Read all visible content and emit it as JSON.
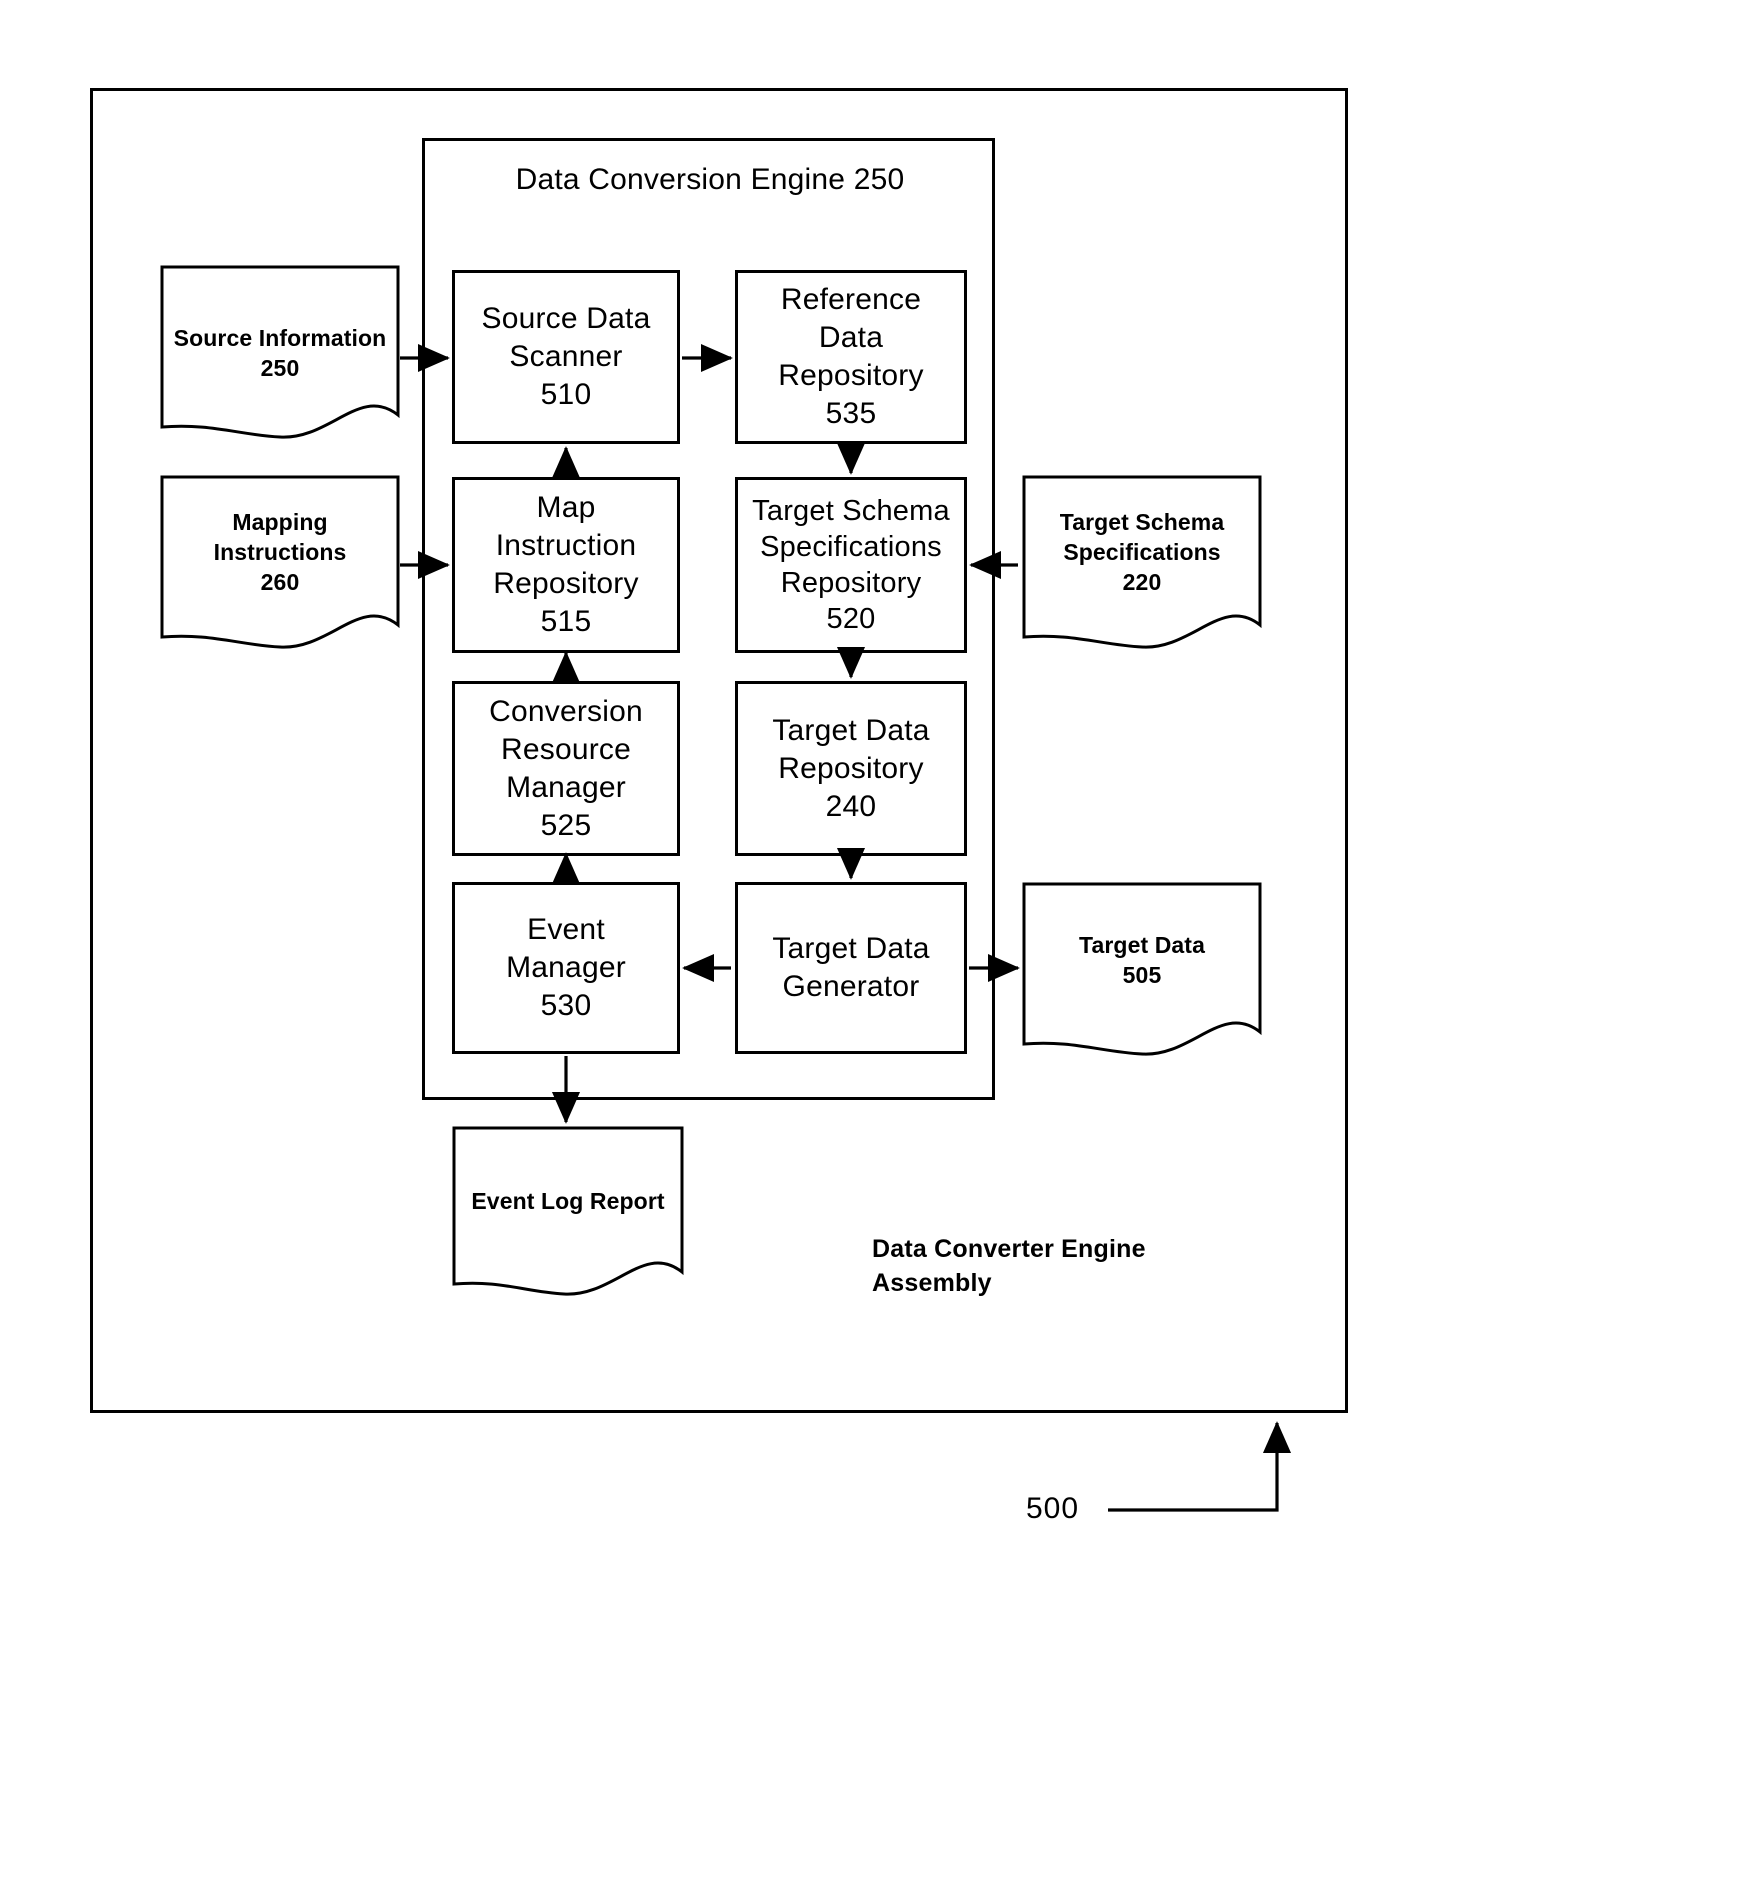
{
  "figure": {
    "reference_number": "500",
    "assembly_label": "Data Converter Engine\nAssembly"
  },
  "engine": {
    "title": "Data Conversion\nEngine 250"
  },
  "documents": [
    {
      "name": "source-information",
      "label": "Source Information\n250"
    },
    {
      "name": "mapping-instructions",
      "label": "Mapping\nInstructions\n260"
    },
    {
      "name": "target-schema-specifications",
      "label": "Target Schema\nSpecifications\n220"
    },
    {
      "name": "target-data",
      "label": "Target Data\n505"
    },
    {
      "name": "event-log-report",
      "label": "Event Log Report"
    }
  ],
  "boxes": [
    {
      "name": "source-data-scanner",
      "label": "Source Data\nScanner\n510"
    },
    {
      "name": "reference-data-repository",
      "label": "Reference\nData\nRepository\n535"
    },
    {
      "name": "map-instruction-repository",
      "label": "Map\nInstruction\nRepository\n515"
    },
    {
      "name": "target-schema-specifications-repository",
      "label": "Target Schema\nSpecifications\nRepository\n520"
    },
    {
      "name": "conversion-resource-manager",
      "label": "Conversion\nResource\nManager\n525"
    },
    {
      "name": "target-data-repository",
      "label": "Target Data\nRepository\n240"
    },
    {
      "name": "event-manager",
      "label": "Event\nManager\n530"
    },
    {
      "name": "target-data-generator",
      "label": "Target Data\nGenerator"
    }
  ],
  "colors": {
    "stroke": "#000000",
    "background": "#ffffff"
  }
}
